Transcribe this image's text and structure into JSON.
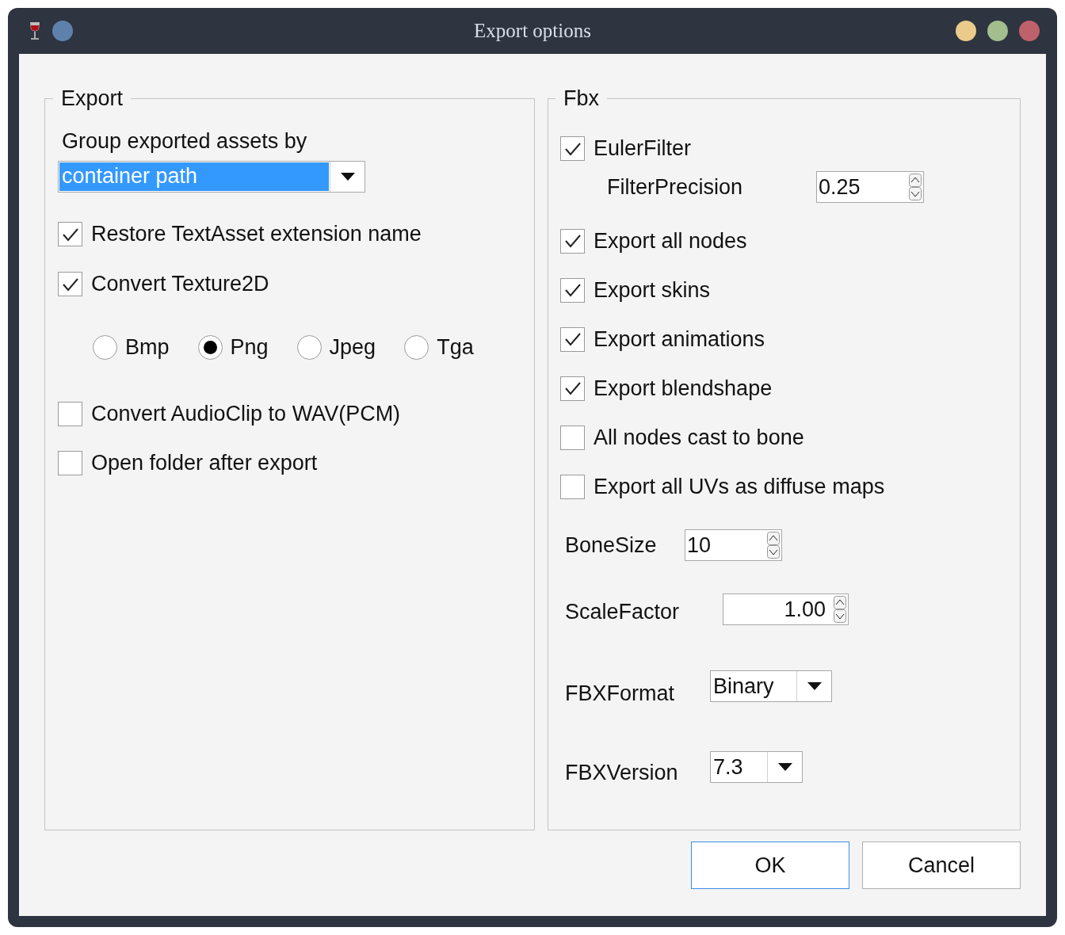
{
  "window": {
    "title": "Export options"
  },
  "export": {
    "title": "Export",
    "group_by_label": "Group exported assets by",
    "group_by_value": "container path",
    "restore_textasset": {
      "label": "Restore TextAsset extension name",
      "checked": true
    },
    "convert_texture": {
      "label": "Convert Texture2D",
      "checked": true
    },
    "formats": [
      {
        "label": "Bmp",
        "selected": false
      },
      {
        "label": "Png",
        "selected": true
      },
      {
        "label": "Jpeg",
        "selected": false
      },
      {
        "label": "Tga",
        "selected": false
      }
    ],
    "convert_audio": {
      "label": "Convert AudioClip to WAV(PCM)",
      "checked": false
    },
    "open_folder": {
      "label": "Open folder after export",
      "checked": false
    }
  },
  "fbx": {
    "title": "Fbx",
    "euler_filter": {
      "label": "EulerFilter",
      "checked": true
    },
    "filter_precision": {
      "label": "FilterPrecision",
      "value": "0.25"
    },
    "options": [
      {
        "label": "Export all nodes",
        "checked": true
      },
      {
        "label": "Export skins",
        "checked": true
      },
      {
        "label": "Export animations",
        "checked": true
      },
      {
        "label": "Export blendshape",
        "checked": true
      },
      {
        "label": "All nodes cast to bone",
        "checked": false
      },
      {
        "label": "Export all UVs as diffuse maps",
        "checked": false
      }
    ],
    "bone_size": {
      "label": "BoneSize",
      "value": "10"
    },
    "scale_factor": {
      "label": "ScaleFactor",
      "value": "1.00"
    },
    "fbx_format": {
      "label": "FBXFormat",
      "value": "Binary"
    },
    "fbx_version": {
      "label": "FBXVersion",
      "value": "7.3"
    }
  },
  "buttons": [
    {
      "label": "OK",
      "selected": true
    },
    {
      "label": "Cancel",
      "selected": false
    }
  ]
}
